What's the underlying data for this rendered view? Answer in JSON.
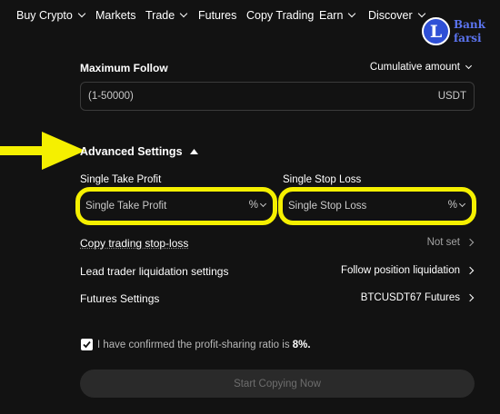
{
  "nav": {
    "items": [
      {
        "label": "Buy Crypto",
        "dropdown": true
      },
      {
        "label": "Markets",
        "dropdown": false
      },
      {
        "label": "Trade",
        "dropdown": true
      },
      {
        "label": "Futures",
        "dropdown": false
      },
      {
        "label": "Copy Trading",
        "dropdown": false
      },
      {
        "label": "Earn",
        "dropdown": true
      },
      {
        "label": "Discover",
        "dropdown": true
      }
    ]
  },
  "logo": {
    "badge": "L",
    "line1": "Bank",
    "line2": "farsi"
  },
  "max_follow": {
    "label": "Maximum Follow",
    "mode": "Cumulative amount",
    "placeholder": "(1-50000)",
    "unit": "USDT"
  },
  "advanced": {
    "label": "Advanced Settings"
  },
  "take_profit": {
    "label": "Single Take Profit",
    "placeholder": "Single Take Profit",
    "unit": "%"
  },
  "stop_loss": {
    "label": "Single Stop Loss",
    "placeholder": "Single Stop Loss",
    "unit": "%"
  },
  "settings_rows": [
    {
      "label": "Copy trading stop-loss",
      "value": "Not set"
    },
    {
      "label": "Lead trader liquidation settings",
      "value": "Follow position liquidation"
    },
    {
      "label": "Futures Settings",
      "value": "BTCUSDT67 Futures"
    }
  ],
  "confirm": {
    "text": "I have confirmed the profit-sharing ratio is",
    "ratio": "8%."
  },
  "start_button": "Start Copying Now",
  "colors": {
    "highlight": "#f5f000",
    "accent": "#2f50d6",
    "background": "#121212"
  }
}
